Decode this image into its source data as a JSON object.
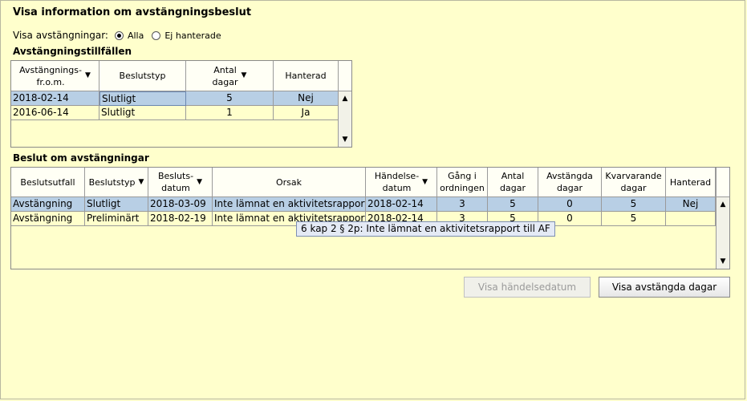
{
  "page": {
    "title": "Visa information om avstängningsbeslut"
  },
  "filter": {
    "label": "Visa avstängningar:",
    "options": [
      {
        "label": "Alla",
        "checked": true
      },
      {
        "label": "Ej hanterade",
        "checked": false
      }
    ]
  },
  "occasions": {
    "title": "Avstängningstillfällen",
    "columns": [
      {
        "label": "Avstängnings-\nfr.o.m.",
        "sortable": true
      },
      {
        "label": "Beslutstyp",
        "sortable": false
      },
      {
        "label": "Antal\ndagar",
        "sortable": true
      },
      {
        "label": "Hanterad",
        "sortable": false
      }
    ],
    "rows": [
      {
        "selected": true,
        "cells": [
          "2018-02-14",
          "Slutligt",
          "5",
          "Nej"
        ]
      },
      {
        "selected": false,
        "cells": [
          "2016-06-14",
          "Slutligt",
          "1",
          "Ja"
        ]
      }
    ]
  },
  "decisions": {
    "title": "Beslut om avstängningar",
    "columns": [
      {
        "label": "Beslutsutfall",
        "sortable": false
      },
      {
        "label": "Beslutstyp",
        "sortable": true
      },
      {
        "label": "Besluts-\ndatum",
        "sortable": true
      },
      {
        "label": "Orsak",
        "sortable": false
      },
      {
        "label": "Händelse-\ndatum",
        "sortable": true
      },
      {
        "label": "Gång i\nordningen",
        "sortable": false
      },
      {
        "label": "Antal\ndagar",
        "sortable": false
      },
      {
        "label": "Avstängda\ndagar",
        "sortable": false
      },
      {
        "label": "Kvarvarande\ndagar",
        "sortable": false
      },
      {
        "label": "Hanterad",
        "sortable": false
      }
    ],
    "rows": [
      {
        "selected": true,
        "cells": [
          "Avstängning",
          "Slutligt",
          "2018-03-09",
          "Inte lämnat en aktivitetsrapport...",
          "2018-02-14",
          "3",
          "5",
          "0",
          "5",
          "Nej"
        ]
      },
      {
        "selected": false,
        "cells": [
          "Avstängning",
          "Preliminärt",
          "2018-02-19",
          "Inte lämnat en aktivitetsrapport...",
          "2018-02-14",
          "3",
          "5",
          "0",
          "5",
          ""
        ]
      }
    ]
  },
  "tooltip": {
    "text": "6 kap 2 § 2p: Inte lämnat en aktivitetsrapport till AF"
  },
  "buttons": {
    "show_event_date": "Visa händelsedatum",
    "show_suspended_days": "Visa avstängda dagar"
  },
  "icons": {
    "sort": "sort-down-icon",
    "scroll_up": "arrow-up-icon",
    "scroll_down": "arrow-down-icon"
  },
  "colors": {
    "background": "#ffffcc",
    "selection": "#b8cfe5",
    "tooltip": "#e4eaf5"
  }
}
